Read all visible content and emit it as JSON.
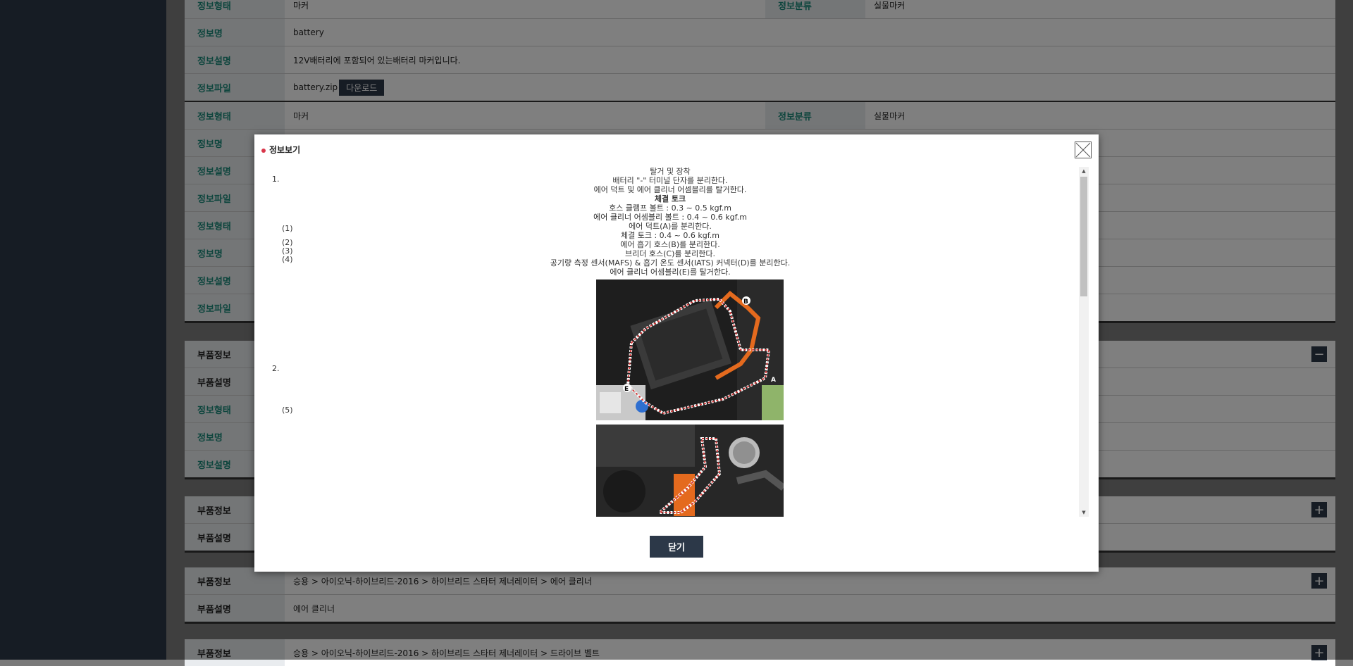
{
  "background_rows": {
    "block1": [
      {
        "label1": "정보형태",
        "value1": "마커",
        "label2": "정보분류",
        "value2": "실물마커"
      },
      {
        "label": "정보명",
        "value": "battery"
      },
      {
        "label": "정보설명",
        "value": "12V배터리에 포함되어 있는배터리 마커입니다."
      },
      {
        "label": "정보파일",
        "value": "battery.zip",
        "button": "다운로드"
      }
    ],
    "block2": [
      {
        "label1": "정보형태",
        "value1": "마커",
        "label2": "정보분류",
        "value2": "실물마커"
      },
      {
        "label": "정보명"
      },
      {
        "label": "정보설명"
      },
      {
        "label": "정보파일"
      },
      {
        "label": "정보형태"
      },
      {
        "label": "정보명"
      },
      {
        "label": "정보설명"
      },
      {
        "label": "정보파일"
      }
    ],
    "block3": [
      {
        "label": "부품정보",
        "toggle": "−"
      },
      {
        "label": "부품설명"
      },
      {
        "label": "정보형태"
      },
      {
        "label": "정보명"
      },
      {
        "label": "정보설명"
      }
    ],
    "block4": [
      {
        "label": "부품정보",
        "toggle": "+"
      },
      {
        "label": "부품설명"
      }
    ],
    "block5": [
      {
        "label": "부품정보",
        "value": "승용 > 아이오닉-하이브리드-2016 > 하이브리드 스타터 제너레이터 > 에어 클리너",
        "toggle": "+"
      },
      {
        "label": "부품설명",
        "value": "에어 클리너"
      }
    ],
    "block6": [
      {
        "label": "부품정보",
        "value": "승용 > 아이오닉-하이브리드-2016 > 하이브리드 스타터 제너레이터 > 드라이브 벨트",
        "toggle": "+"
      }
    ]
  },
  "modal": {
    "title": "정보보기",
    "close_button": "닫기",
    "step_numbers": {
      "s1": "1.",
      "s1_1": "(1)",
      "s1_2": "(2)",
      "s1_3": "(3)",
      "s1_4": "(4)",
      "s2": "2.",
      "s2_5": "(5)"
    },
    "lines": [
      {
        "text": "탈거 및 장착",
        "bold": false
      },
      {
        "text": "배터리 \"-\" 터미널 단자를 분리한다.",
        "bold": false
      },
      {
        "text": "에어 덕트 및 에어 클리너 어셈블리를 탈거한다.",
        "bold": false
      },
      {
        "text": "체결 토크",
        "bold": true
      },
      {
        "text": "호스 클램프 볼트 : 0.3 ~ 0.5 kgf.m",
        "bold": false
      },
      {
        "text": "에어 클리너 어셈블리 볼트 : 0.4 ~ 0.6 kgf.m",
        "bold": false
      },
      {
        "text": "에어 덕트(A)를 분리한다.",
        "bold": false
      },
      {
        "text": "체결 토크 : 0.4 ~ 0.6 kgf.m",
        "bold": false
      },
      {
        "text": "에어 흡기 호스(B)를 분리한다.",
        "bold": false
      },
      {
        "text": "브리더 호스(C)를 분리한다.",
        "bold": false
      },
      {
        "text": "공기량 측정 센서(MAFS) & 흡기 온도 센서(IATS) 커넥터(D)를 분리한다.",
        "bold": false
      },
      {
        "text": "에어 클리너 어셈블리(E)를 탈거한다.",
        "bold": false
      }
    ],
    "photo_labels": {
      "a": "A",
      "b": "B",
      "e": "E"
    }
  },
  "colors": {
    "dark_navy": "#2c3848",
    "label_teal": "#1a8a7a",
    "accent_red": "#d9374b"
  }
}
